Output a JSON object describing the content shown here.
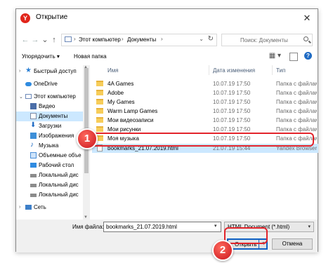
{
  "window": {
    "title": "Открытие",
    "close_glyph": "✕"
  },
  "nav": {
    "back": "←",
    "forward": "→",
    "dropdown": "⌄",
    "up": "↑"
  },
  "address": {
    "crumbs": [
      "Этот компьютер",
      "Документы"
    ],
    "separator": "›",
    "dropdown_glyph": "⌄",
    "refresh_glyph": "↻"
  },
  "search": {
    "placeholder": "Поиск: Документы"
  },
  "toolbar": {
    "organize": "Упорядочить ▾",
    "new_folder": "Новая папка",
    "view_glyph": "▦ ▾",
    "help_glyph": "?"
  },
  "sidebar": {
    "items": [
      {
        "label": "Быстрый доступ",
        "icon": "star-icon"
      },
      {
        "label": "OneDrive",
        "icon": "cloud-icon"
      },
      {
        "label": "Этот компьютер",
        "icon": "computer-icon"
      },
      {
        "label": "Видео",
        "icon": "video-icon"
      },
      {
        "label": "Документы",
        "icon": "documents-icon",
        "selected": true
      },
      {
        "label": "Загрузки",
        "icon": "downloads-icon"
      },
      {
        "label": "Изображения",
        "icon": "images-icon"
      },
      {
        "label": "Музыка",
        "icon": "music-icon"
      },
      {
        "label": "Объемные объе",
        "icon": "3d-objects-icon"
      },
      {
        "label": "Рабочий стол",
        "icon": "desktop-icon"
      },
      {
        "label": "Локальный дис",
        "icon": "drive-icon"
      },
      {
        "label": "Локальный дис",
        "icon": "drive-icon"
      },
      {
        "label": "Локальный дис",
        "icon": "drive-icon"
      },
      {
        "label": "Сеть",
        "icon": "network-icon"
      }
    ]
  },
  "columns": {
    "name": "Имя",
    "date": "Дата изменения",
    "type": "Тип"
  },
  "files": [
    {
      "name": "4A Games",
      "date": "10.07.19 17:50",
      "type": "Папка с файлами",
      "kind": "folder"
    },
    {
      "name": "Adobe",
      "date": "10.07.19 17:50",
      "type": "Папка с файлами",
      "kind": "folder"
    },
    {
      "name": "My Games",
      "date": "10.07.19 17:50",
      "type": "Папка с файлами",
      "kind": "folder"
    },
    {
      "name": "Warm Lamp Games",
      "date": "10.07.19 17:50",
      "type": "Папка с файлами",
      "kind": "folder"
    },
    {
      "name": "Мои видеозаписи",
      "date": "10.07.19 17:50",
      "type": "Папка с файлами",
      "kind": "folder"
    },
    {
      "name": "Мои рисунки",
      "date": "10.07.19 17:50",
      "type": "Папка с файлами",
      "kind": "folder"
    },
    {
      "name": "Моя музыка",
      "date": "10.07.19 17:50",
      "type": "Папка с файлами",
      "kind": "folder"
    },
    {
      "name": "bookmarks_21.07.2019.html",
      "date": "21.07.19 15:44",
      "type": "Yandex Browser H...",
      "kind": "file",
      "selected": true
    }
  ],
  "bottom": {
    "filename_label": "Имя файла:",
    "filename_value": "bookmarks_21.07.2019.html",
    "filetype": "HTML Document (*.html)",
    "open": "Открыть",
    "cancel": "Отмена",
    "dropdown_glyph": "▾"
  },
  "badges": {
    "one": "1",
    "two": "2"
  },
  "colors": {
    "highlight": "#e3242b",
    "selection": "#cce8ff",
    "accent": "#0f60c4"
  }
}
